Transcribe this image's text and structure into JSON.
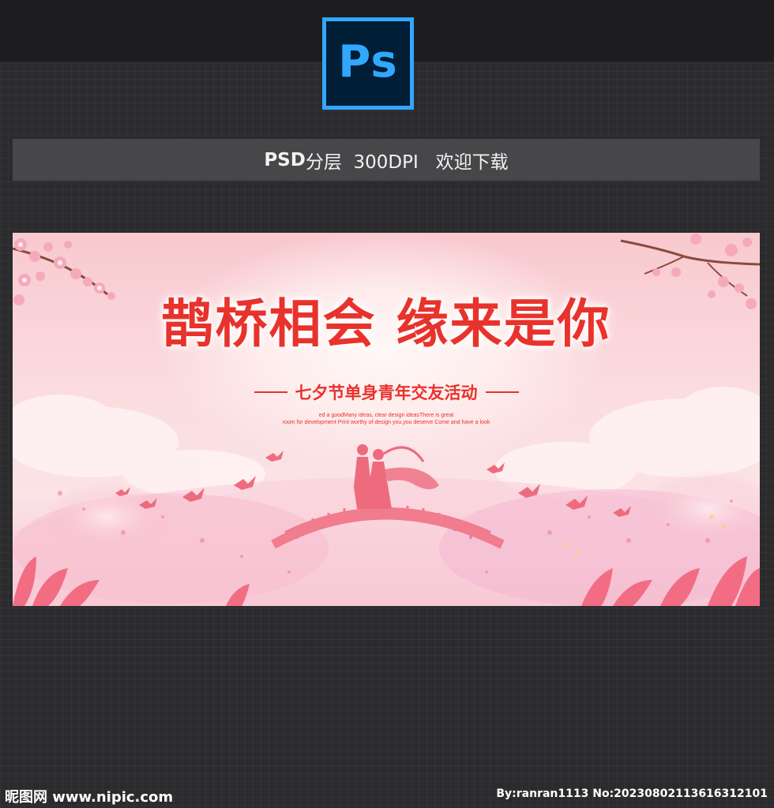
{
  "header": {
    "logo_text": "Ps",
    "info_bold": "PSD",
    "info_rest": "分层  300DPI   欢迎下载"
  },
  "banner": {
    "title": "鹊桥相会 缘来是你",
    "subtitle": "七夕节单身青年交友活动",
    "english_line_1": "ed a goodMany ideas, clear design ideasThere is great",
    "english_line_2": "room for development Print worthy of design you,you deserve Come and have a look",
    "colors": {
      "title": "#e8322c",
      "background": "#fbdde0",
      "accent_pink": "#f07c8e"
    }
  },
  "footer": {
    "site": "昵图网 www.nipic.com",
    "id_text": "By:ranran1113 No:20230802113616312101"
  }
}
